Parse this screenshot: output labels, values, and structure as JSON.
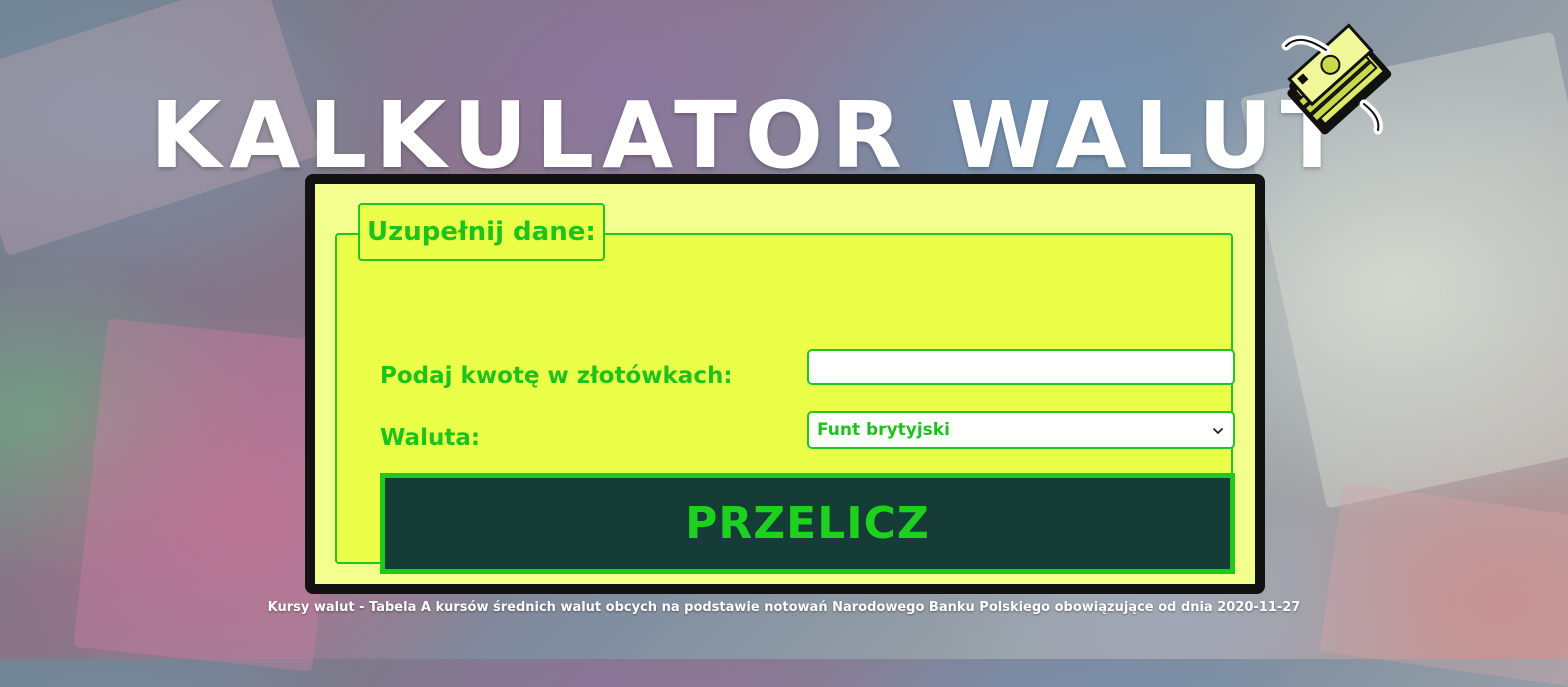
{
  "header": {
    "title": "KALKULATOR WALUT",
    "logo_icon": "money-stack-icon"
  },
  "form": {
    "legend": "Uzupełnij dane:",
    "amount_label": "Podaj kwotę w złotówkach:",
    "amount_value": "",
    "currency_label": "Waluta:",
    "currency_selected": "Funt brytyjski",
    "submit_label": "PRZELICZ"
  },
  "footer": {
    "note": "Kursy walut - Tabela A kursów średnich walut obcych na podstawie notowań Narodowego Banku Polskiego obowiązujące od dnia 2020-11-27"
  },
  "colors": {
    "accent_green": "#1ec21e",
    "panel_bg": "#ebff48",
    "button_bg": "#163c38",
    "frame": "#121212"
  }
}
